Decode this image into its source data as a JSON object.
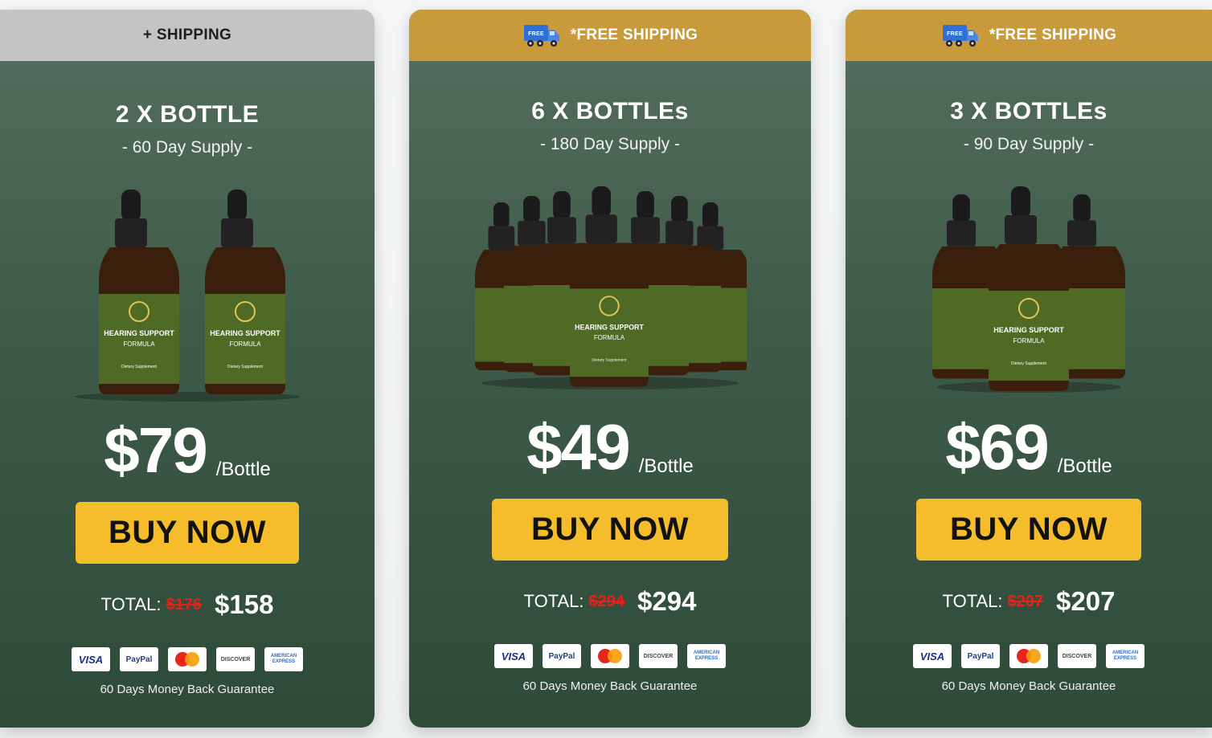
{
  "offers": [
    {
      "banner": "+ SHIPPING",
      "banner_style": "gray",
      "title": "2 X BOTTLE",
      "subtitle": "- 60 Day Supply -",
      "bottle_count": 2,
      "price": "$79",
      "per": "/Bottle",
      "buy_label": "BUY NOW",
      "total_label": "TOTAL:",
      "total_old": "$176",
      "total_new": "$158",
      "guarantee": "60 Days Money Back Guarantee"
    },
    {
      "banner": "*FREE SHIPPING",
      "banner_style": "gold",
      "title": "6 X BOTTLEs",
      "subtitle": "- 180 Day Supply -",
      "bottle_count": 6,
      "price": "$49",
      "per": "/Bottle",
      "buy_label": "BUY NOW",
      "total_label": "TOTAL:",
      "total_old": "$294",
      "total_new": "$294",
      "guarantee": "60 Days Money Back Guarantee"
    },
    {
      "banner": "*FREE SHIPPING",
      "banner_style": "gold",
      "title": "3 X BOTTLEs",
      "subtitle": "- 90 Day Supply -",
      "bottle_count": 3,
      "price": "$69",
      "per": "/Bottle",
      "buy_label": "BUY NOW",
      "total_label": "TOTAL:",
      "total_old": "$207",
      "total_new": "$207",
      "guarantee": "60 Days Money Back Guarantee"
    }
  ],
  "product_label": {
    "line1": "HEARING SUPPORT",
    "line2": "FORMULA",
    "line3": "Dietary Supplement"
  },
  "truck_badge": "FREE",
  "payment_methods": [
    "VISA",
    "PayPal",
    "mastercard",
    "DISCOVER",
    "AMERICAN EXPRESS"
  ],
  "colors": {
    "card_green": "#3e5a48",
    "banner_gold": "#c99a3c",
    "banner_gray": "#c4c4c4",
    "buy_button": "#f5bc2b",
    "strike_red": "#e2231a"
  }
}
